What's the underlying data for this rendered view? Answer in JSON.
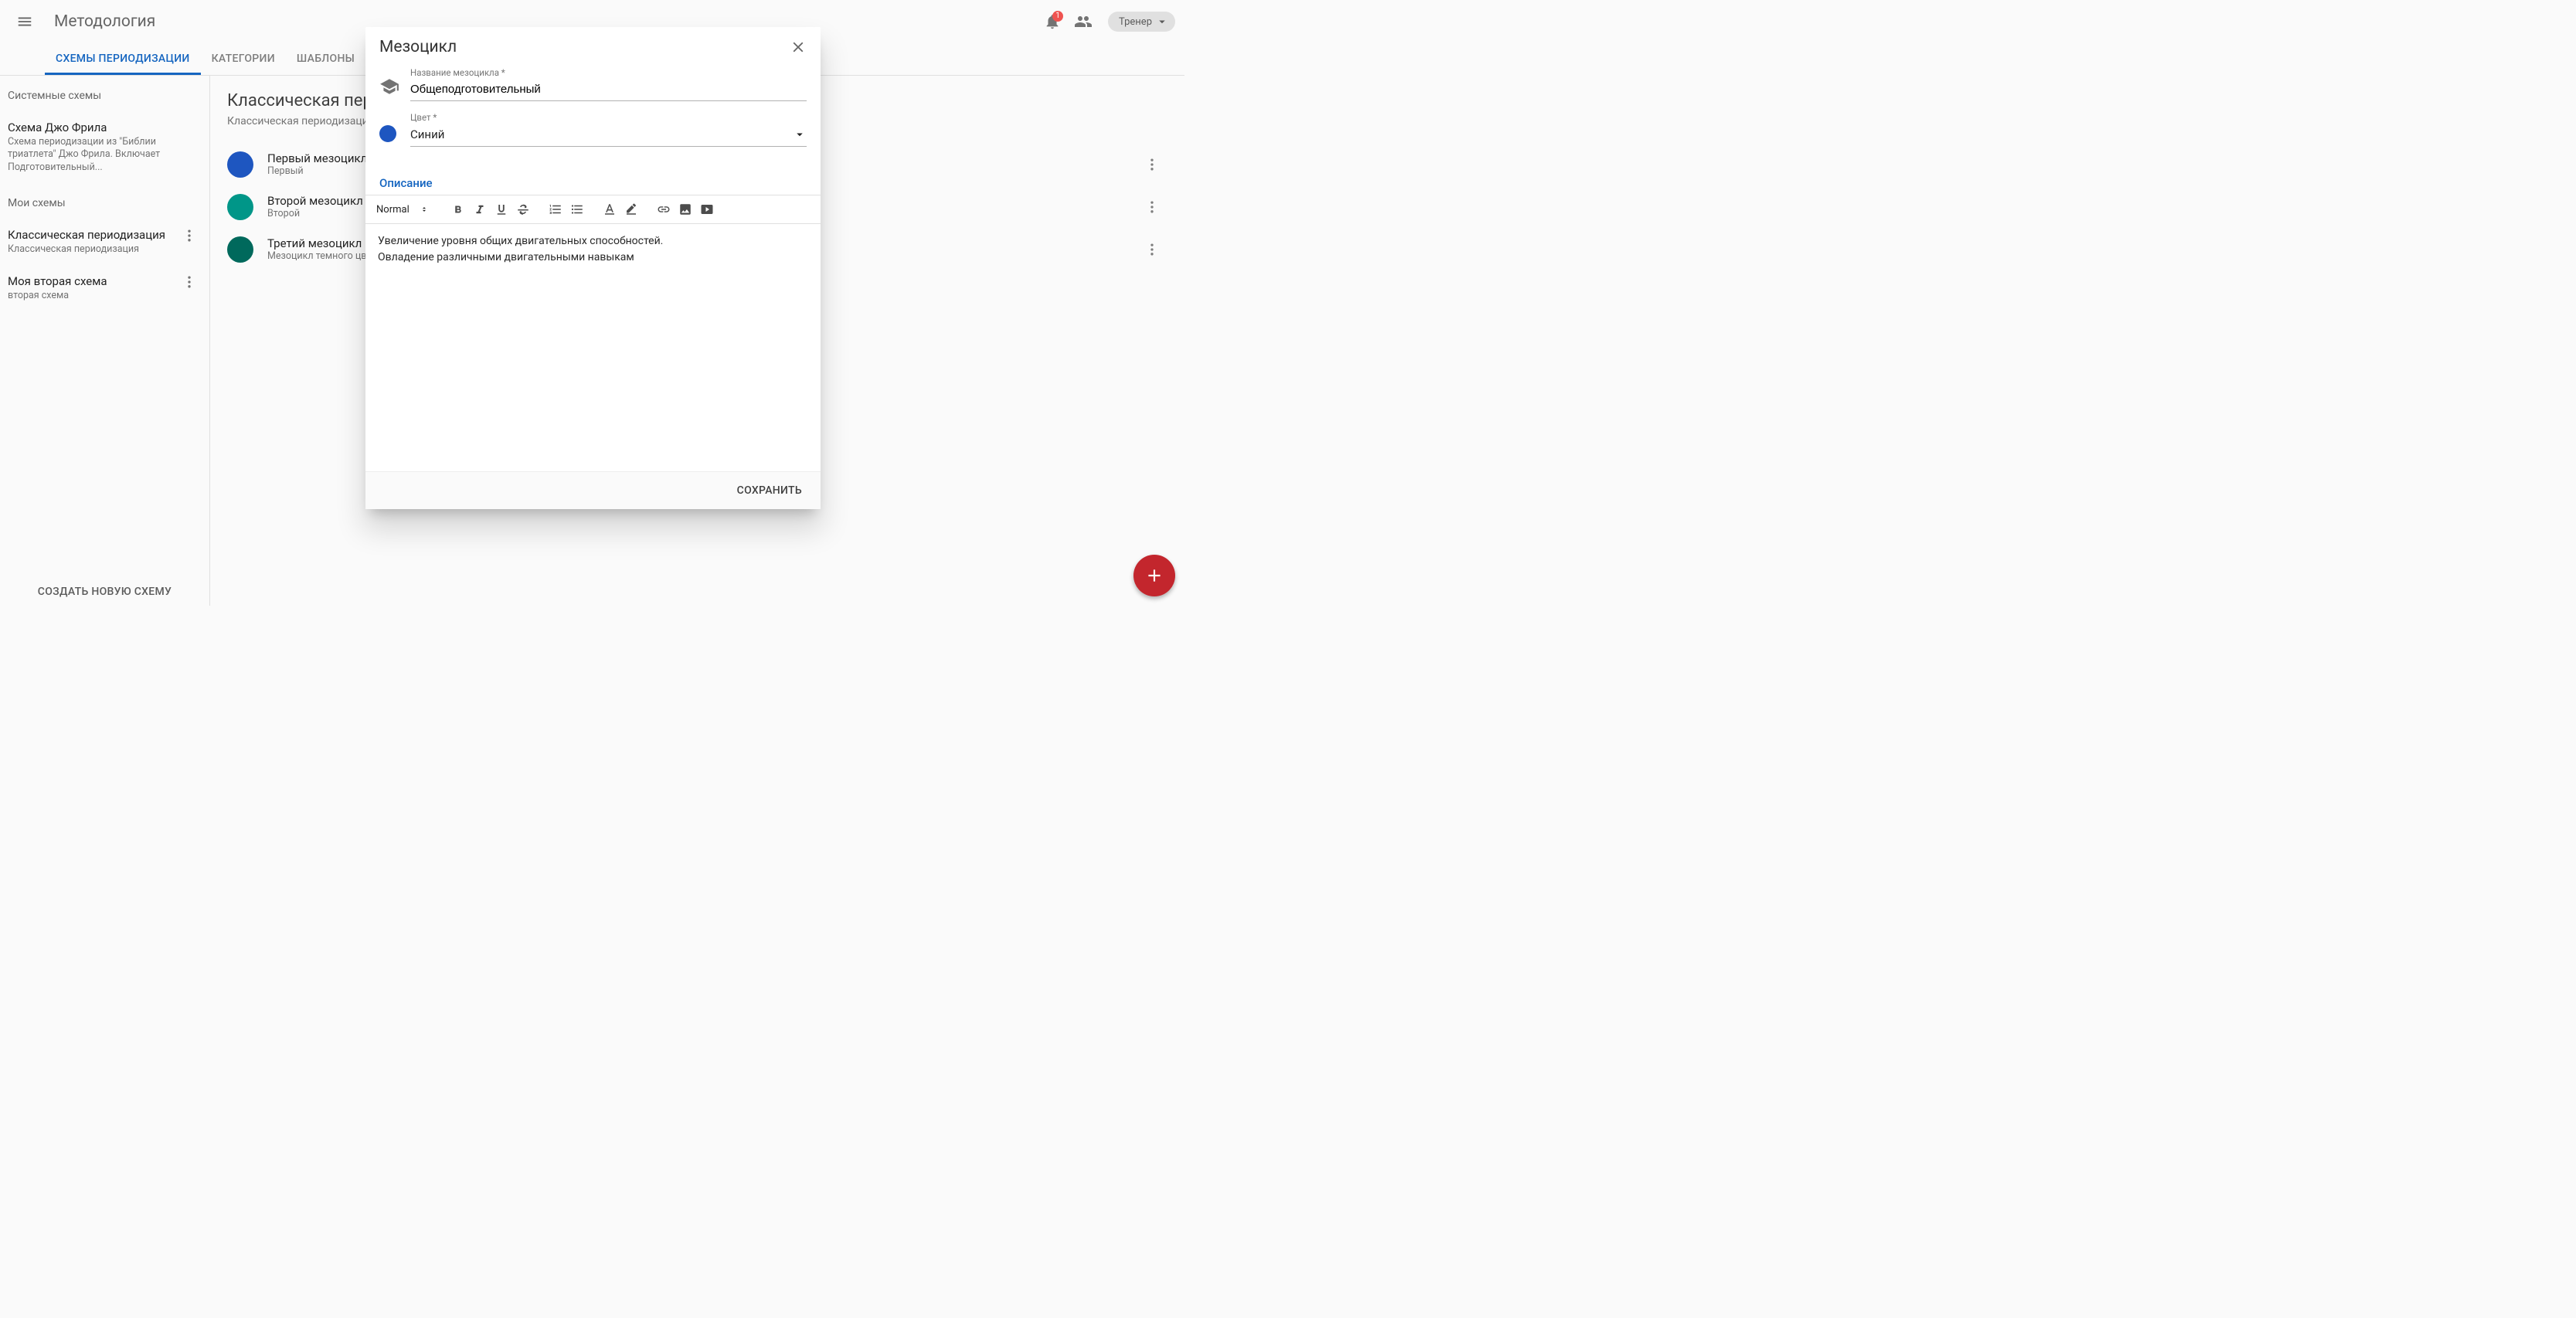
{
  "topbar": {
    "title": "Методология",
    "notification_count": "1",
    "role_label": "Тренер"
  },
  "tabs": {
    "items": [
      {
        "label": "СХЕМЫ ПЕРИОДИЗАЦИИ",
        "active": true
      },
      {
        "label": "КАТЕГОРИИ",
        "active": false
      },
      {
        "label": "ШАБЛОНЫ",
        "active": false
      }
    ]
  },
  "sidebar": {
    "system_section_label": "Системные схемы",
    "system_items": [
      {
        "title": "Схема Джо Фрила",
        "subtitle": "Схема периодизации из \"Библии триатлета\" Джо Фрила. Включает Подготовительный..."
      }
    ],
    "my_section_label": "Мои схемы",
    "my_items": [
      {
        "title": "Классическая периодизация",
        "subtitle": "Классическая периодизация"
      },
      {
        "title": "Моя вторая схема",
        "subtitle": "вторая схема"
      }
    ],
    "create_button": "СОЗДАТЬ НОВУЮ СХЕМУ"
  },
  "main": {
    "title": "Классическая периодиза",
    "subtitle": "Классическая периодизация",
    "mesocycles": [
      {
        "title": "Первый мезоцикл",
        "subtitle": "Первый",
        "color": "c-blue"
      },
      {
        "title": "Второй мезоцикл",
        "subtitle": "Второй",
        "color": "c-teal"
      },
      {
        "title": "Третий мезоцикл",
        "subtitle": "Мезоцикл темного цвет",
        "color": "c-tealdk"
      }
    ]
  },
  "dialog": {
    "title": "Мезоцикл",
    "name_label": "Название мезоцикла *",
    "name_value": "Общеподготовительный",
    "color_label": "Цвет *",
    "color_value": "Синий",
    "color_hex": "#1e56c0",
    "description_label": "Описание",
    "toolbar_format": "Normal",
    "editor_line1": "Увеличение уровня общих двигательных способностей.",
    "editor_line2": "Овладение различными двигательными навыкам",
    "save_label": "СОХРАНИТЬ"
  }
}
